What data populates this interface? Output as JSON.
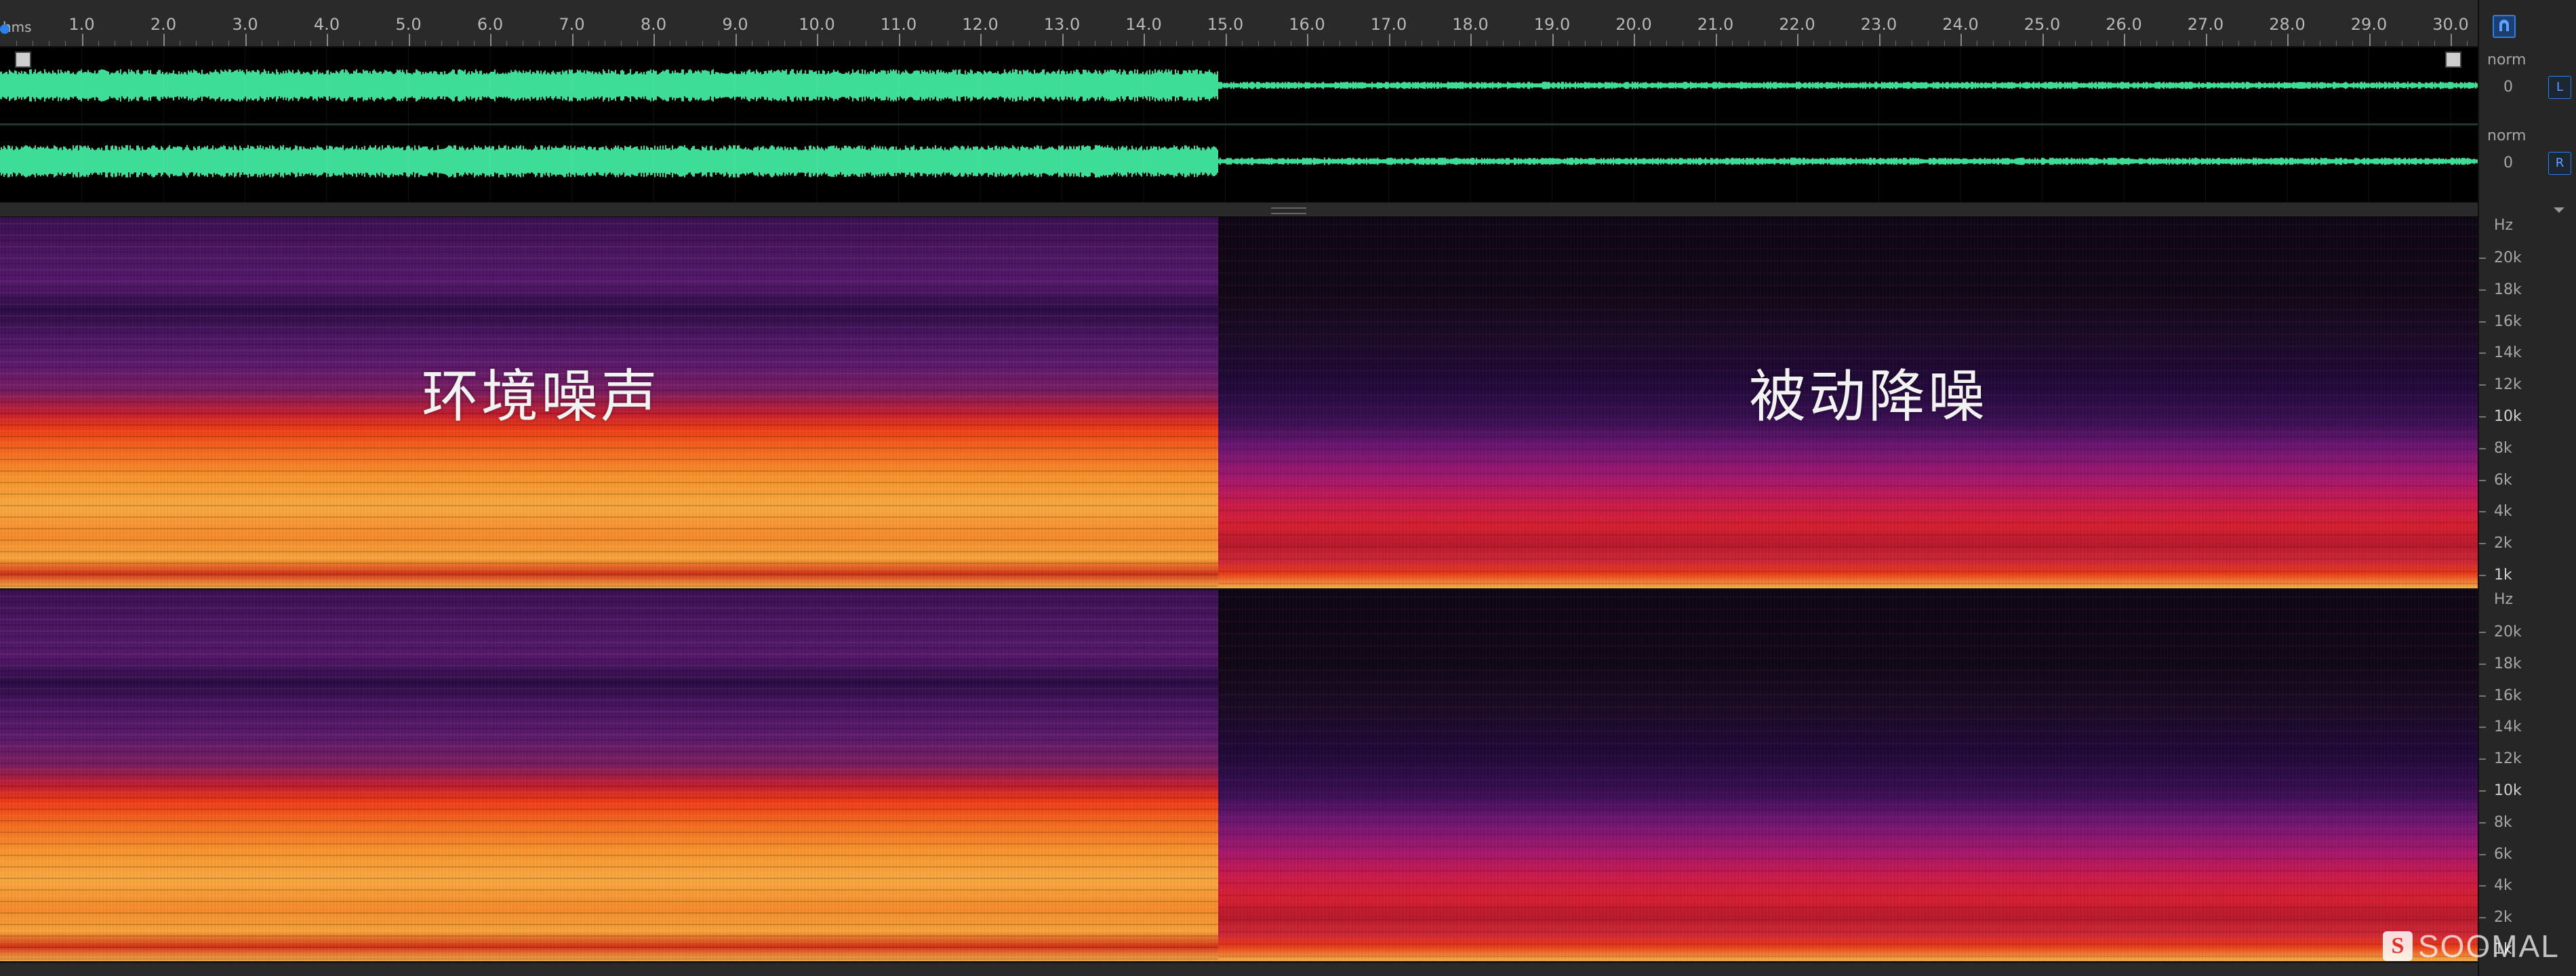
{
  "ruler": {
    "unit": "hms",
    "labels": [
      "1.0",
      "2.0",
      "3.0",
      "4.0",
      "5.0",
      "6.0",
      "7.0",
      "8.0",
      "9.0",
      "10.0",
      "11.0",
      "12.0",
      "13.0",
      "14.0",
      "15.0",
      "16.0",
      "17.0",
      "18.0",
      "19.0",
      "20.0",
      "21.0",
      "22.0",
      "23.0",
      "24.0",
      "25.0",
      "26.0",
      "27.0",
      "28.0",
      "29.0",
      "30.0"
    ]
  },
  "waveform": {
    "left_channel": {
      "scale_top": "norm",
      "scale_zero": "0",
      "button": "L"
    },
    "right_channel": {
      "scale_top": "norm",
      "scale_zero": "0",
      "button": "R"
    },
    "wave_color": "#3ddc97"
  },
  "spectrogram": {
    "unit": "Hz",
    "ticks": [
      "20k",
      "18k",
      "16k",
      "14k",
      "12k",
      "10k",
      "8k",
      "6k",
      "4k",
      "2k",
      "1k"
    ],
    "caption_left": "环境噪声",
    "caption_right": "被动降噪"
  },
  "watermark": {
    "icon_letter": "S",
    "text": "SOOMAL"
  },
  "icons": {
    "pin": "pin-icon",
    "fade_in": "fade-in-handle-icon",
    "fade_out": "fade-out-handle-icon"
  }
}
